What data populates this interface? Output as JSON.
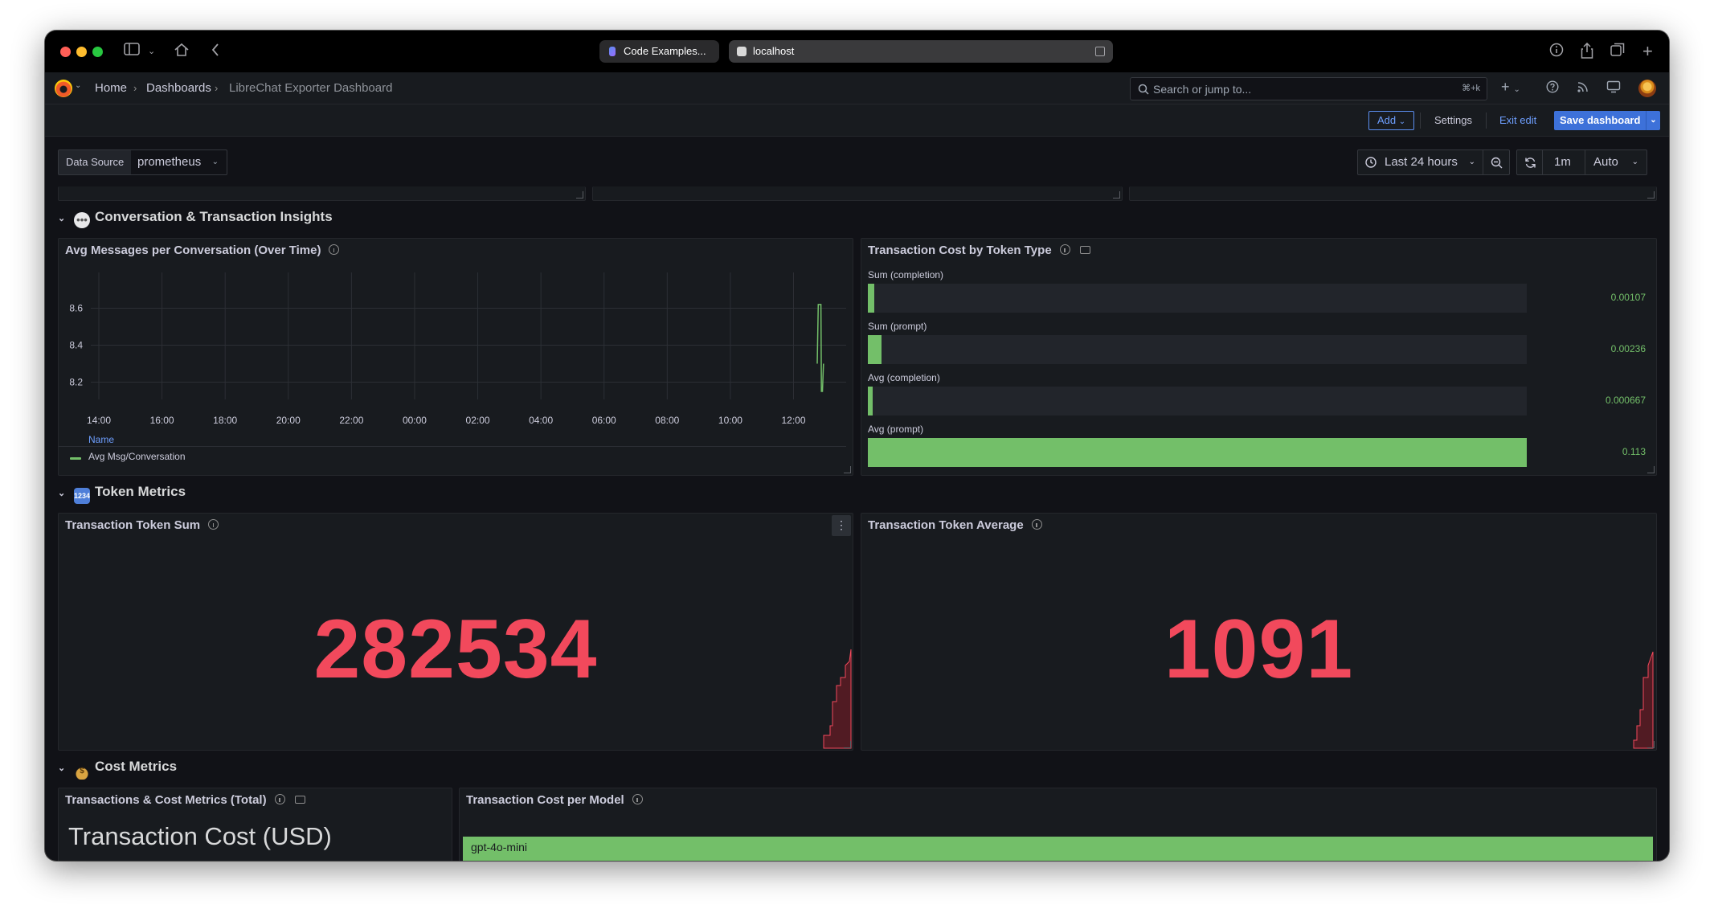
{
  "browser": {
    "tabs": [
      {
        "label": "Code Examples..."
      },
      {
        "label": "localhost"
      }
    ]
  },
  "nav": {
    "breadcrumbs": [
      "Home",
      "Dashboards",
      "LibreChat Exporter Dashboard"
    ],
    "search_placeholder": "Search or jump to...",
    "search_shortcut": "⌘+k"
  },
  "toolbar": {
    "add_label": "Add",
    "settings_label": "Settings",
    "exit_edit_label": "Exit edit",
    "save_label": "Save dashboard"
  },
  "variables": {
    "data_source_label": "Data Source",
    "data_source_value": "prometheus"
  },
  "time_controls": {
    "range": "Last 24 hours",
    "refresh_interval": "1m",
    "mode": "Auto"
  },
  "rows": {
    "conversation": {
      "title": "Conversation & Transaction Insights",
      "icon": "speech-bubble-icon"
    },
    "token": {
      "title": "Token Metrics",
      "icon": "numbers-icon"
    },
    "cost": {
      "title": "Cost Metrics",
      "icon": "money-bag-icon"
    }
  },
  "panels": {
    "avg_messages": {
      "title": "Avg Messages per Conversation (Over Time)",
      "legend_header": "Name",
      "legend_item": "Avg Msg/Conversation"
    },
    "cost_by_token_type": {
      "title": "Transaction Cost by Token Type"
    },
    "token_sum": {
      "title": "Transaction Token Sum",
      "value": "282534"
    },
    "token_avg": {
      "title": "Transaction Token Average",
      "value": "1091"
    },
    "cost_totals": {
      "title": "Transactions & Cost Metrics (Total)",
      "stat_label": "Transaction Cost (USD)"
    },
    "cost_per_model": {
      "title": "Transaction Cost per Model",
      "bar_label": "gpt-4o-mini",
      "bar_fraction": 1.0
    }
  },
  "chart_data": [
    {
      "type": "line",
      "title": "Avg Messages per Conversation (Over Time)",
      "x_ticks": [
        "14:00",
        "16:00",
        "18:00",
        "20:00",
        "22:00",
        "00:00",
        "02:00",
        "04:00",
        "06:00",
        "08:00",
        "10:00",
        "12:00"
      ],
      "y_ticks": [
        8.2,
        8.4,
        8.6
      ],
      "ylim": [
        8.15,
        8.75
      ],
      "series": [
        {
          "name": "Avg Msg/Conversation",
          "color": "#73bf69",
          "x": [
            "12:45",
            "12:47",
            "12:49",
            "12:50",
            "12:51",
            "12:52",
            "12:53",
            "12:55",
            "12:57"
          ],
          "y": [
            8.3,
            8.62,
            8.62,
            8.62,
            8.62,
            8.62,
            8.15,
            8.15,
            8.3
          ]
        }
      ]
    },
    {
      "type": "bar",
      "orientation": "horizontal",
      "title": "Transaction Cost by Token Type",
      "categories": [
        "Sum (completion)",
        "Sum (prompt)",
        "Avg (completion)",
        "Avg (prompt)"
      ],
      "values": [
        0.00107,
        0.00236,
        0.000667,
        0.113
      ],
      "labels": [
        "0.00107",
        "0.00236",
        "0.000667",
        "0.113"
      ],
      "xlim": [
        0,
        0.113
      ],
      "color": "#73bf69"
    }
  ]
}
